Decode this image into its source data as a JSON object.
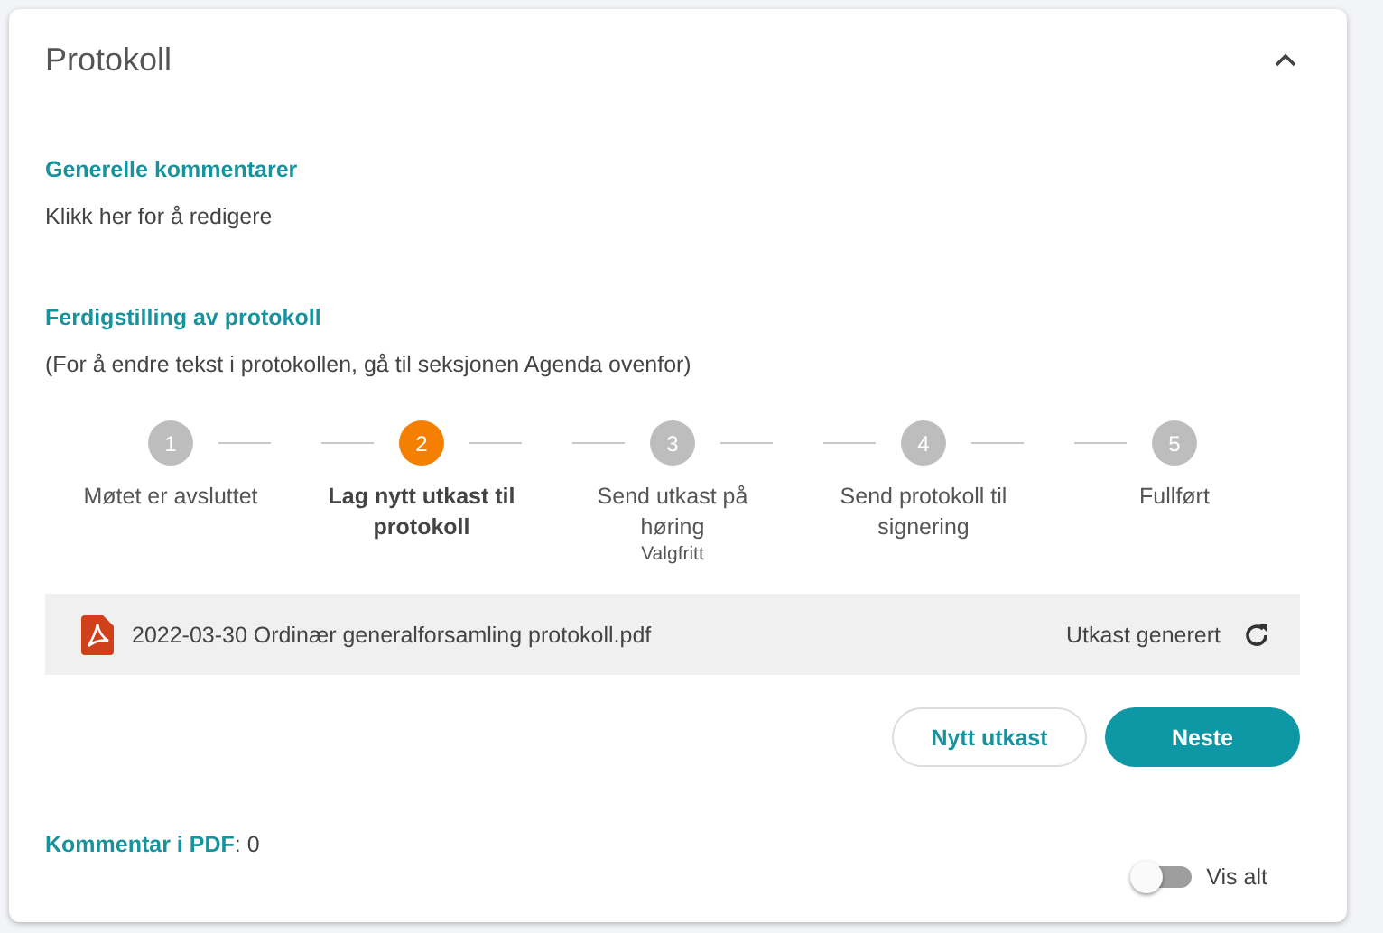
{
  "panel": {
    "title": "Protokoll",
    "expanded": true
  },
  "general_comments": {
    "heading": "Generelle kommentarer",
    "text": "Klikk her for å redigere"
  },
  "finalization": {
    "heading": "Ferdigstilling av protokoll",
    "note": "(For å endre tekst i protokollen, gå til seksjonen Agenda ovenfor)"
  },
  "steps": [
    {
      "number": "1",
      "label": "Møtet er avsluttet",
      "selected": false
    },
    {
      "number": "2",
      "label": "Lag nytt utkast til protokoll",
      "selected": true
    },
    {
      "number": "3",
      "label": "Send utkast på høring",
      "sublabel": "Valgfritt",
      "selected": false
    },
    {
      "number": "4",
      "label": "Send protokoll til signering",
      "selected": false
    },
    {
      "number": "5",
      "label": "Fullført",
      "selected": false
    }
  ],
  "file": {
    "name": "2022-03-30 Ordinær generalforsamling protokoll.pdf",
    "status": "Utkast generert"
  },
  "buttons": [
    {
      "label": "Nytt utkast",
      "kind": "secondary"
    },
    {
      "label": "Neste",
      "kind": "primary"
    }
  ],
  "pdf_comments": "**Kommentar i PDF**: 0",
  "show_all": {
    "label": "Vis alt",
    "on": false
  }
}
